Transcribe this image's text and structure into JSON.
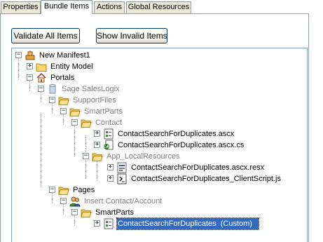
{
  "tabs": [
    {
      "label": "Properties"
    },
    {
      "label": "Bundle Items"
    },
    {
      "label": "Actions"
    },
    {
      "label": "Global Resources"
    }
  ],
  "buttons": {
    "validate_all": "Validate All Items",
    "show_invalid": "Show Invalid Items"
  },
  "tree": {
    "items": [
      {
        "label": "New Manifest1",
        "icon": "manifest-icon",
        "expander": "−"
      },
      {
        "label": "Entity Model",
        "icon": "folder-icon",
        "expander": "+"
      },
      {
        "label": "Portals",
        "icon": "house-icon",
        "expander": "−"
      },
      {
        "label": "Sage SalesLogix",
        "icon": "portal-cylinder-icon",
        "expander": "−"
      },
      {
        "label": "SupportFiles",
        "icon": "folder-open-icon",
        "expander": "−"
      },
      {
        "label": "SmartParts",
        "icon": "folder-open-icon",
        "expander": "−"
      },
      {
        "label": "Contact",
        "icon": "folder-open-icon",
        "expander": "−"
      },
      {
        "label": "ContactSearchForDuplicates.ascx",
        "icon": "ascx-file-icon",
        "expander": "+"
      },
      {
        "label": "ContactSearchForDuplicates.ascx.cs",
        "icon": "cs-file-icon",
        "expander": "+"
      },
      {
        "label": "App_LocalResources",
        "icon": "folder-open-icon",
        "expander": "−"
      },
      {
        "label": "ContactSearchForDuplicates.ascx.resx",
        "icon": "resx-file-icon",
        "expander": "+"
      },
      {
        "label": "ContactSearchForDuplicates_ClientScript.js",
        "icon": "js-file-icon",
        "expander": "+"
      },
      {
        "label": "Pages",
        "icon": "folder-open-icon",
        "expander": "−"
      },
      {
        "label": "Insert Contact/Account",
        "icon": "users-icon",
        "expander": "−"
      },
      {
        "label": "SmartParts",
        "icon": "folder-open-icon",
        "expander": "−"
      },
      {
        "label": "ContactSearchForDuplicates  (Custom)",
        "icon": "ascx-file-icon",
        "expander": "+"
      }
    ]
  },
  "colors": {
    "selection": "#316ac5",
    "folder": "#f5d86a",
    "grayed_text": "#808080"
  }
}
